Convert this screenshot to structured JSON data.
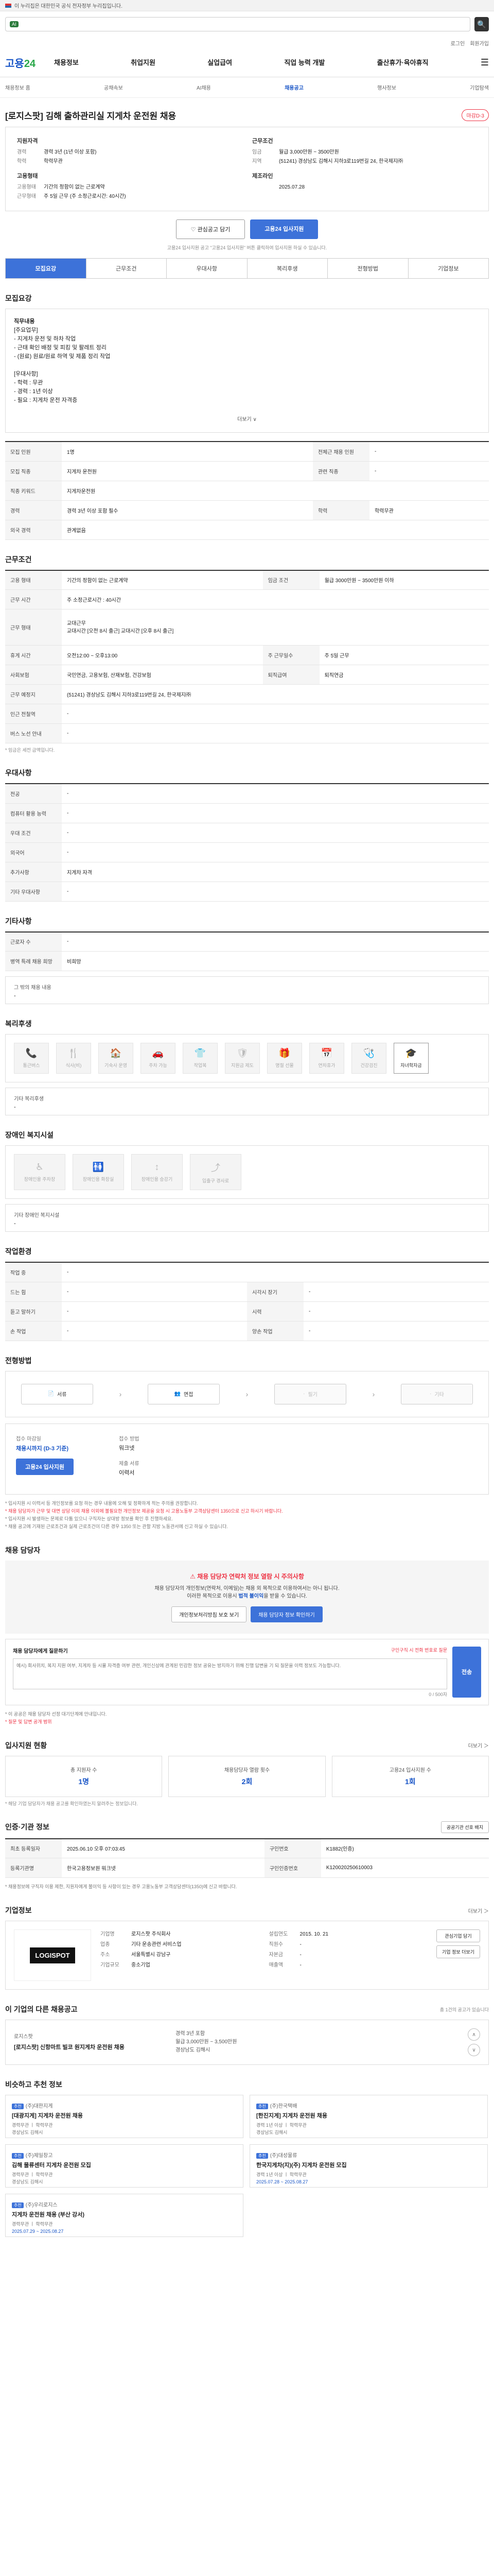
{
  "gov_banner": "이 누리집은 대한민국 공식 전자정부 누리집입니다.",
  "search": {
    "badge": "AI",
    "placeholder": "",
    "button": "🔍"
  },
  "util_links": [
    "로그인",
    "회원가입"
  ],
  "gnb": {
    "logo_main": "고용",
    "logo_sub": "24",
    "menu": [
      "채용정보",
      "취업지원",
      "실업급여",
      "직업 능력 개발",
      "출산휴가·육아휴직",
      "☰"
    ]
  },
  "subnav": [
    "채용정보 홈",
    "공채속보",
    "AI채용",
    "채용공고",
    "행사정보",
    "기업탐색"
  ],
  "job": {
    "title": "[로지스팟] 김해 출하관리실 지게차 운전원 채용",
    "badge": "마감D-3",
    "sections": {
      "applicant": {
        "head": "지원자격",
        "rows": [
          [
            "경력",
            "경력 3년 (1년 이상 포함)"
          ],
          [
            "학력",
            "학력무관"
          ]
        ]
      },
      "conditions": {
        "head": "근무조건",
        "rows": [
          [
            "임금",
            "월급 3,000만원 ~ 3500만원"
          ],
          [
            "지역",
            "(51241) 경상남도 김해시 지하3로119번길 24, 한국제지㈜"
          ]
        ]
      },
      "employ": {
        "head": "고용형태",
        "rows": [
          [
            "고용형태",
            "기간의 정함이 없는 근로계약"
          ],
          [
            "근무형태",
            "주 5일 근무 (주 소정근로시간: 40시간)"
          ]
        ]
      },
      "bizhead": {
        "head": "제조라인",
        "rows": [
          [
            "",
            "2025.07.28"
          ]
        ]
      }
    },
    "btn_scrap": "관심공고 담기",
    "btn_apply": "고용24 입사지원",
    "note": "고용24 입사지원 공고 \"고용24 입사지원\" 버튼 클릭하여 입사지원 하실 수 있습니다."
  },
  "tabs": [
    "모집요강",
    "근무조건",
    "우대사항",
    "복리후생",
    "전형방법",
    "기업정보"
  ],
  "duty": {
    "title": "모집요강",
    "lines": [
      "직무내용",
      "[주요업무]",
      "- 지게차 운전 및 하차 작업",
      "- 근태 확인 배정 및 피킹 및 팔레트 정리",
      "- (원료) 원료/원료 하역 및 제품 정리 작업",
      "",
      "[우대사항]",
      "- 학력 : 무관",
      "- 경력 : 1년 이상",
      "- 필요 : 지게차 운전 자격증"
    ],
    "more": "더보기 ∨"
  },
  "recruit_table": [
    [
      "모집 인원",
      "1명",
      "전체근 채용 인원",
      "-"
    ],
    [
      "모집 직종",
      "지게차 운전원",
      "관련 직종",
      "-"
    ],
    [
      "직종 키워드",
      "지게차운전원",
      "",
      ""
    ],
    [
      "경력",
      "경력 3년 이상 포함 필수",
      "학력",
      "학력무관"
    ],
    [
      "외국 경력",
      "관계없음",
      "",
      ""
    ]
  ],
  "work_title": "근무조건",
  "work_table": [
    [
      "고용 형태",
      "기간의 정함이 없는 근로계약",
      "임금 조건",
      "월급 3000만원 ~ 3500만원 이하"
    ],
    [
      "근무 시간",
      "주 소정근로시간 : 40시간",
      "",
      ""
    ],
    [
      "근무 형태",
      "교대근무\n교대시간 [오전 8시 출근] 교대시간 [오후 8시 출근]",
      "",
      ""
    ],
    [
      "휴게 시간",
      "오전12:00 ~ 오후13:00",
      "주 근무일수",
      "주 5일 근무"
    ],
    [
      "사회보험",
      "국민연금, 고용보험, 산재보험, 건강보험",
      "퇴직급여",
      "퇴직연금"
    ],
    [
      "근무 예정지",
      "(51241) 경상남도 김해시 지하3로119번길 24, 한국제지㈜",
      "",
      ""
    ],
    [
      "인근 전철역",
      "-",
      "",
      ""
    ],
    [
      "버스 노선 안내",
      "-",
      "",
      ""
    ]
  ],
  "work_note": "* 임금은 세전 금액입니다.",
  "pref_title": "우대사항",
  "pref_table": [
    [
      "전공",
      "-"
    ],
    [
      "컴퓨터 활용 능력",
      "-"
    ],
    [
      "우대 조건",
      "-"
    ],
    [
      "외국어",
      "-"
    ],
    [
      "추가사항",
      "지게차 자격"
    ],
    [
      "기타 우대사항",
      "-"
    ]
  ],
  "other_title": "기타사항",
  "other_table": [
    [
      "근로자 수",
      "-"
    ],
    [
      "병역 특례 채용 희망",
      "비희망"
    ]
  ],
  "other_misc": {
    "label": "그 밖의 채용 내용",
    "value": "-"
  },
  "welfare_title": "복리후생",
  "welfare": [
    {
      "icon": "📞",
      "label": "통근버스",
      "on": false
    },
    {
      "icon": "🍴",
      "label": "식사(비)",
      "on": false
    },
    {
      "icon": "🏠",
      "label": "기숙사 운영",
      "on": false
    },
    {
      "icon": "🚗",
      "label": "주차 가능",
      "on": false
    },
    {
      "icon": "👕",
      "label": "작업복",
      "on": false
    },
    {
      "icon": "🛡",
      "label": "지원금 제도",
      "on": false
    },
    {
      "icon": "🎁",
      "label": "명절 선물",
      "on": false
    },
    {
      "icon": "📅",
      "label": "연차휴가",
      "on": false
    },
    {
      "icon": "🩺",
      "label": "건강검진",
      "on": false
    },
    {
      "icon": "🎓",
      "label": "자녀학자금",
      "on": true
    }
  ],
  "welfare_etc": {
    "label": "기타 복리후생",
    "value": "-"
  },
  "disability_title": "장애인 복지시설",
  "disability": [
    {
      "icon": "♿",
      "label": "장애인용 주차장"
    },
    {
      "icon": "🚻",
      "label": "장애인용 화장실"
    },
    {
      "icon": "↕",
      "label": "장애인용 승강기"
    },
    {
      "icon": "⤴",
      "label": "입출구 경사로"
    }
  ],
  "disability_etc": {
    "label": "기타 장애인 복지시설",
    "value": "-"
  },
  "work_env_title": "작업환경",
  "work_env_table": [
    [
      "작업 중",
      "-",
      "",
      ""
    ],
    [
      "드는 힘",
      "-",
      "시각시 장기",
      "-"
    ],
    [
      "듣고 말하기",
      "-",
      "시력",
      "-"
    ],
    [
      "손 작업",
      "-",
      "양손 작업",
      "-"
    ]
  ],
  "process_title": "전형방법",
  "process": [
    {
      "icon": "📄",
      "label": "서류",
      "dim": false
    },
    {
      "icon": "👥",
      "label": "면접",
      "dim": false
    },
    {
      "icon": "·",
      "label": "필기",
      "dim": true
    },
    {
      "icon": "·",
      "label": "기타",
      "dim": true
    }
  ],
  "apply": {
    "l1": "접수 마감일",
    "v1": "채용시까지 (D-3 기준)",
    "btn": "고용24 입사지원",
    "r1": "접수 방법",
    "rv1": "워크넷",
    "r2": "제출 서류",
    "rv2": "이력서",
    "bullets": [
      "* 입사지원 시 이력서 등 개인정보를 요청 하는 경우 내용에 오해 및 정확하게 적는 주의를 권장합니다.",
      "* 채용 담당자가 근무 및 대면 상담 이외 채용 이외에 불필요한 개인정보 제공을 요청 시 고용노동부 고객상담센터 1350으로 신고 하시기 바랍니다.",
      "* 입사지원 시 발생하는 문제로 다툼 있으니 구직자는 상대방 정보를 확인 후 진행하세요.",
      "* 채용 공고에 기재된 근로조건과 실제 근로조건이 다른 경우 1350 또는 관할 지방 노동관서에 신고 하실 수 있습니다."
    ]
  },
  "contact": {
    "title": "채용 담당자",
    "t1": "채용 담당자 연락처 정보 열람 시 주의사항",
    "t2a": "채용 담당자의 개인정보(연락처, 이메일)는 채용 외 목적으로 이용하여서는 아니 됩니다.",
    "t2b": "이러한 목적으로 이용시 ",
    "t2c": "법적 불이익",
    "t2d": "을 받을 수 있습니다.",
    "b1": "개인정보처리방침 보호 보기",
    "b2": "채용 담당자 정보 확인하기",
    "q_label": "채용 담당자에게 질문하기",
    "q_meta": "구인구직 시 전화 번호로 질문",
    "q_placeholder": "예시) 회사위치, 복지 지원 여부, 지게차 등 시뮬 자격증 여부 관련, 개인신상에 관계된 민감한 정보 공유는 방지하기 위해 진행 답변을 기 되 질문을 이력 정보도 가능합니다.",
    "q_count": "0 / 500자",
    "q_send": "전송",
    "q_notes": [
      "* 이 공공은 채용 담당자 선정 대기단계에 안내입니다.",
      "* 질문 및 답변 공개 범위"
    ]
  },
  "status": {
    "title": "입사지원 현황",
    "more": "더보기 ＞",
    "cards": [
      {
        "label": "총 지원자 수",
        "value": "1명"
      },
      {
        "label": "채용담당자 열람 횟수",
        "value": "2회"
      },
      {
        "label": "고용24 입사지원 수",
        "value": "1회"
      }
    ],
    "note": "* 해당 기업 담당자가 채용 공고를 확인하였는지 알려주는 정보입니다."
  },
  "reg": {
    "title": "인증·기관 정보",
    "btn": "공공기관 선호 배지",
    "rows": [
      [
        "최초 등록일자",
        "2025.06.10 오후 07:03:45",
        "구인번호",
        "K1882(인증)"
      ],
      [
        "등록기관명",
        "한국고용정보원 워크넷",
        "구인인증번호",
        "K120020250610003"
      ]
    ],
    "notes": [
      "* 채용정보에 구직자 이용 제한, 지원자에게 불이익 등 사항이 있는 경우 고용노동부 고객상담센터(1350)에 신고 바랍니다."
    ]
  },
  "company": {
    "title": "기업정보",
    "more": "더보기 ＞",
    "logo": "LOGISPOT",
    "rows": [
      [
        "기업명",
        "로지스팟 주식회사",
        "설립연도",
        "2015. 10. 21"
      ],
      [
        "업종",
        "기타 운송관련 서비스업",
        "직원수",
        "-"
      ],
      [
        "주소",
        "서울특별시 강남구",
        "자본금",
        "-"
      ],
      [
        "기업규모",
        "중소기업",
        "매출액",
        "-"
      ]
    ],
    "btns": [
      "관심기업 담기",
      "기업 정보 더보기"
    ]
  },
  "other": {
    "title": "이 기업의 다른 채용공고",
    "note": "총 1건의 공고가 있습니다",
    "co": "로지스팟",
    "name": "[로지스팟] 신항마트 빌코 원지게차 운전원 채용",
    "meta": [
      "경력 3년 포함",
      "월급 3,000만원 ~ 3,500만원",
      "경상남도 김해시"
    ],
    "prev": "∧",
    "next": "∨"
  },
  "rec": {
    "title": "비슷하고 추천 정보",
    "cards": [
      {
        "co": "(주)대한지게",
        "tag": "추천",
        "ttl": "[대광지게] 지게차 운전원 채용",
        "meta": [
          "경력무관 ㅣ 학력무관",
          "경상남도 김해시"
        ]
      },
      {
        "co": "(주)한국택배",
        "tag": "추천",
        "ttl": "[한진지게] 지게차 운전원 채용",
        "meta": [
          "경력 1년 이상 ㅣ 학력무관",
          "경상남도 김해시"
        ]
      },
      {
        "co": "(주)제일창고",
        "tag": "추천",
        "ttl": "김해 물류센터 지게차 운전원 모집",
        "meta": [
          "경력무관 ㅣ 학력무관",
          "경상남도 김해시"
        ]
      },
      {
        "co": "(주)대성물류",
        "tag": "추천",
        "ttl": "한국지게차(지)(주) 지게차 운전원 모집",
        "meta": [
          "경력 1년 이상 ㅣ 학력무관",
          "2025.07.28 ~ 2025.08.27"
        ]
      },
      {
        "co": "(주)우리로지스",
        "tag": "추천",
        "ttl": "지게차 운전원 채용 (부산 강서)",
        "meta": [
          "경력무관 ㅣ 학력무관",
          "2025.07.29 ~ 2025.08.27"
        ]
      }
    ]
  }
}
